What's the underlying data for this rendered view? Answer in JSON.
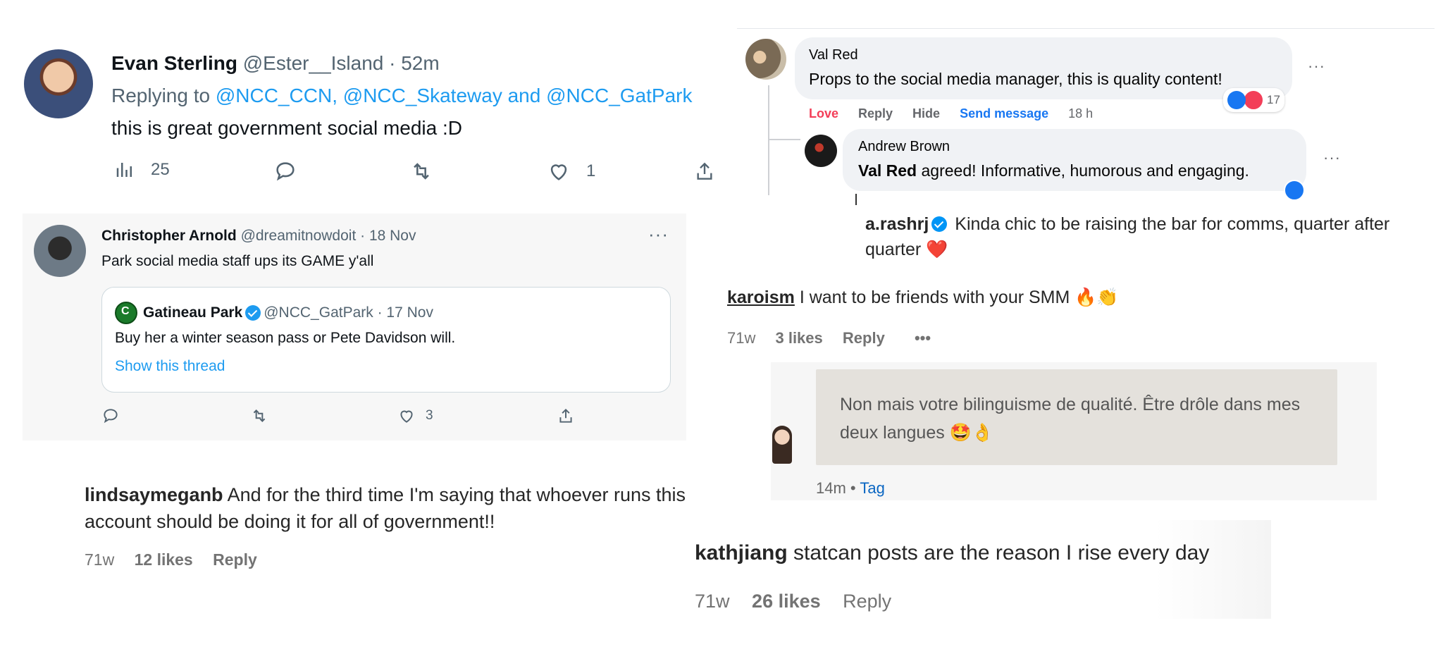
{
  "tweet1": {
    "name": "Evan Sterling",
    "handle_time": "@Ester__Island · 52m",
    "replying_prefix": "Replying to ",
    "reply_to_1": "@NCC_CCN",
    "reply_sep_1": ", ",
    "reply_to_2": "@NCC_Skateway",
    "reply_sep_2": " and ",
    "reply_to_3": "@NCC_GatPark",
    "text": "this is great government social media :D",
    "views": "25",
    "likes": "1"
  },
  "tweet2": {
    "name": "Christopher Arnold",
    "handle_time": "@dreamitnowdoit · 18 Nov",
    "more": "···",
    "text": "Park social media staff ups its GAME y'all",
    "quote": {
      "name": "Gatineau Park",
      "handle_time": "@NCC_GatPark · 17 Nov",
      "text": "Buy her a winter season pass or Pete Davidson will.",
      "show_thread": "Show this thread"
    },
    "likes": "3"
  },
  "ig_lindsay": {
    "user": "lindsaymeganb",
    "text": "And for the third time I'm saying that whoever runs this account should be doing it for all of government!!",
    "time": "71w",
    "likes": "12 likes",
    "reply": "Reply"
  },
  "fb": {
    "comment1": {
      "name": "Val Red",
      "text": "Props to the social media manager, this is quality content!",
      "reactions": "17",
      "more": "···"
    },
    "actions": {
      "love": "Love",
      "reply": "Reply",
      "hide": "Hide",
      "send": "Send message",
      "time": "18 h"
    },
    "comment2": {
      "name": "Andrew Brown",
      "tag": "Val Red",
      "text": " agreed! Informative, humorous and engaging.",
      "more": "···"
    }
  },
  "ig_rashrj": {
    "user": "a.rashrj",
    "text": " Kinda chic to be raising the bar for comms, quarter after quarter ",
    "emoji": "❤️"
  },
  "ig_karoism": {
    "user": "karoism",
    "text": " I want to be friends with your SMM ",
    "emoji": "🔥👏",
    "time": "71w",
    "likes": "3 likes",
    "reply": "Reply",
    "more": "•••"
  },
  "linkedin_fr": {
    "text": "Non mais votre bilinguisme de qualité. Être drôle dans mes deux langues ",
    "emoji": "🤩👌",
    "time": "14m",
    "sep": " • ",
    "tag": "Tag"
  },
  "ig_kathjiang": {
    "user": "kathjiang",
    "text": " statcan posts are the reason I rise every day",
    "time": "71w",
    "likes": "26 likes",
    "reply": "Reply"
  }
}
